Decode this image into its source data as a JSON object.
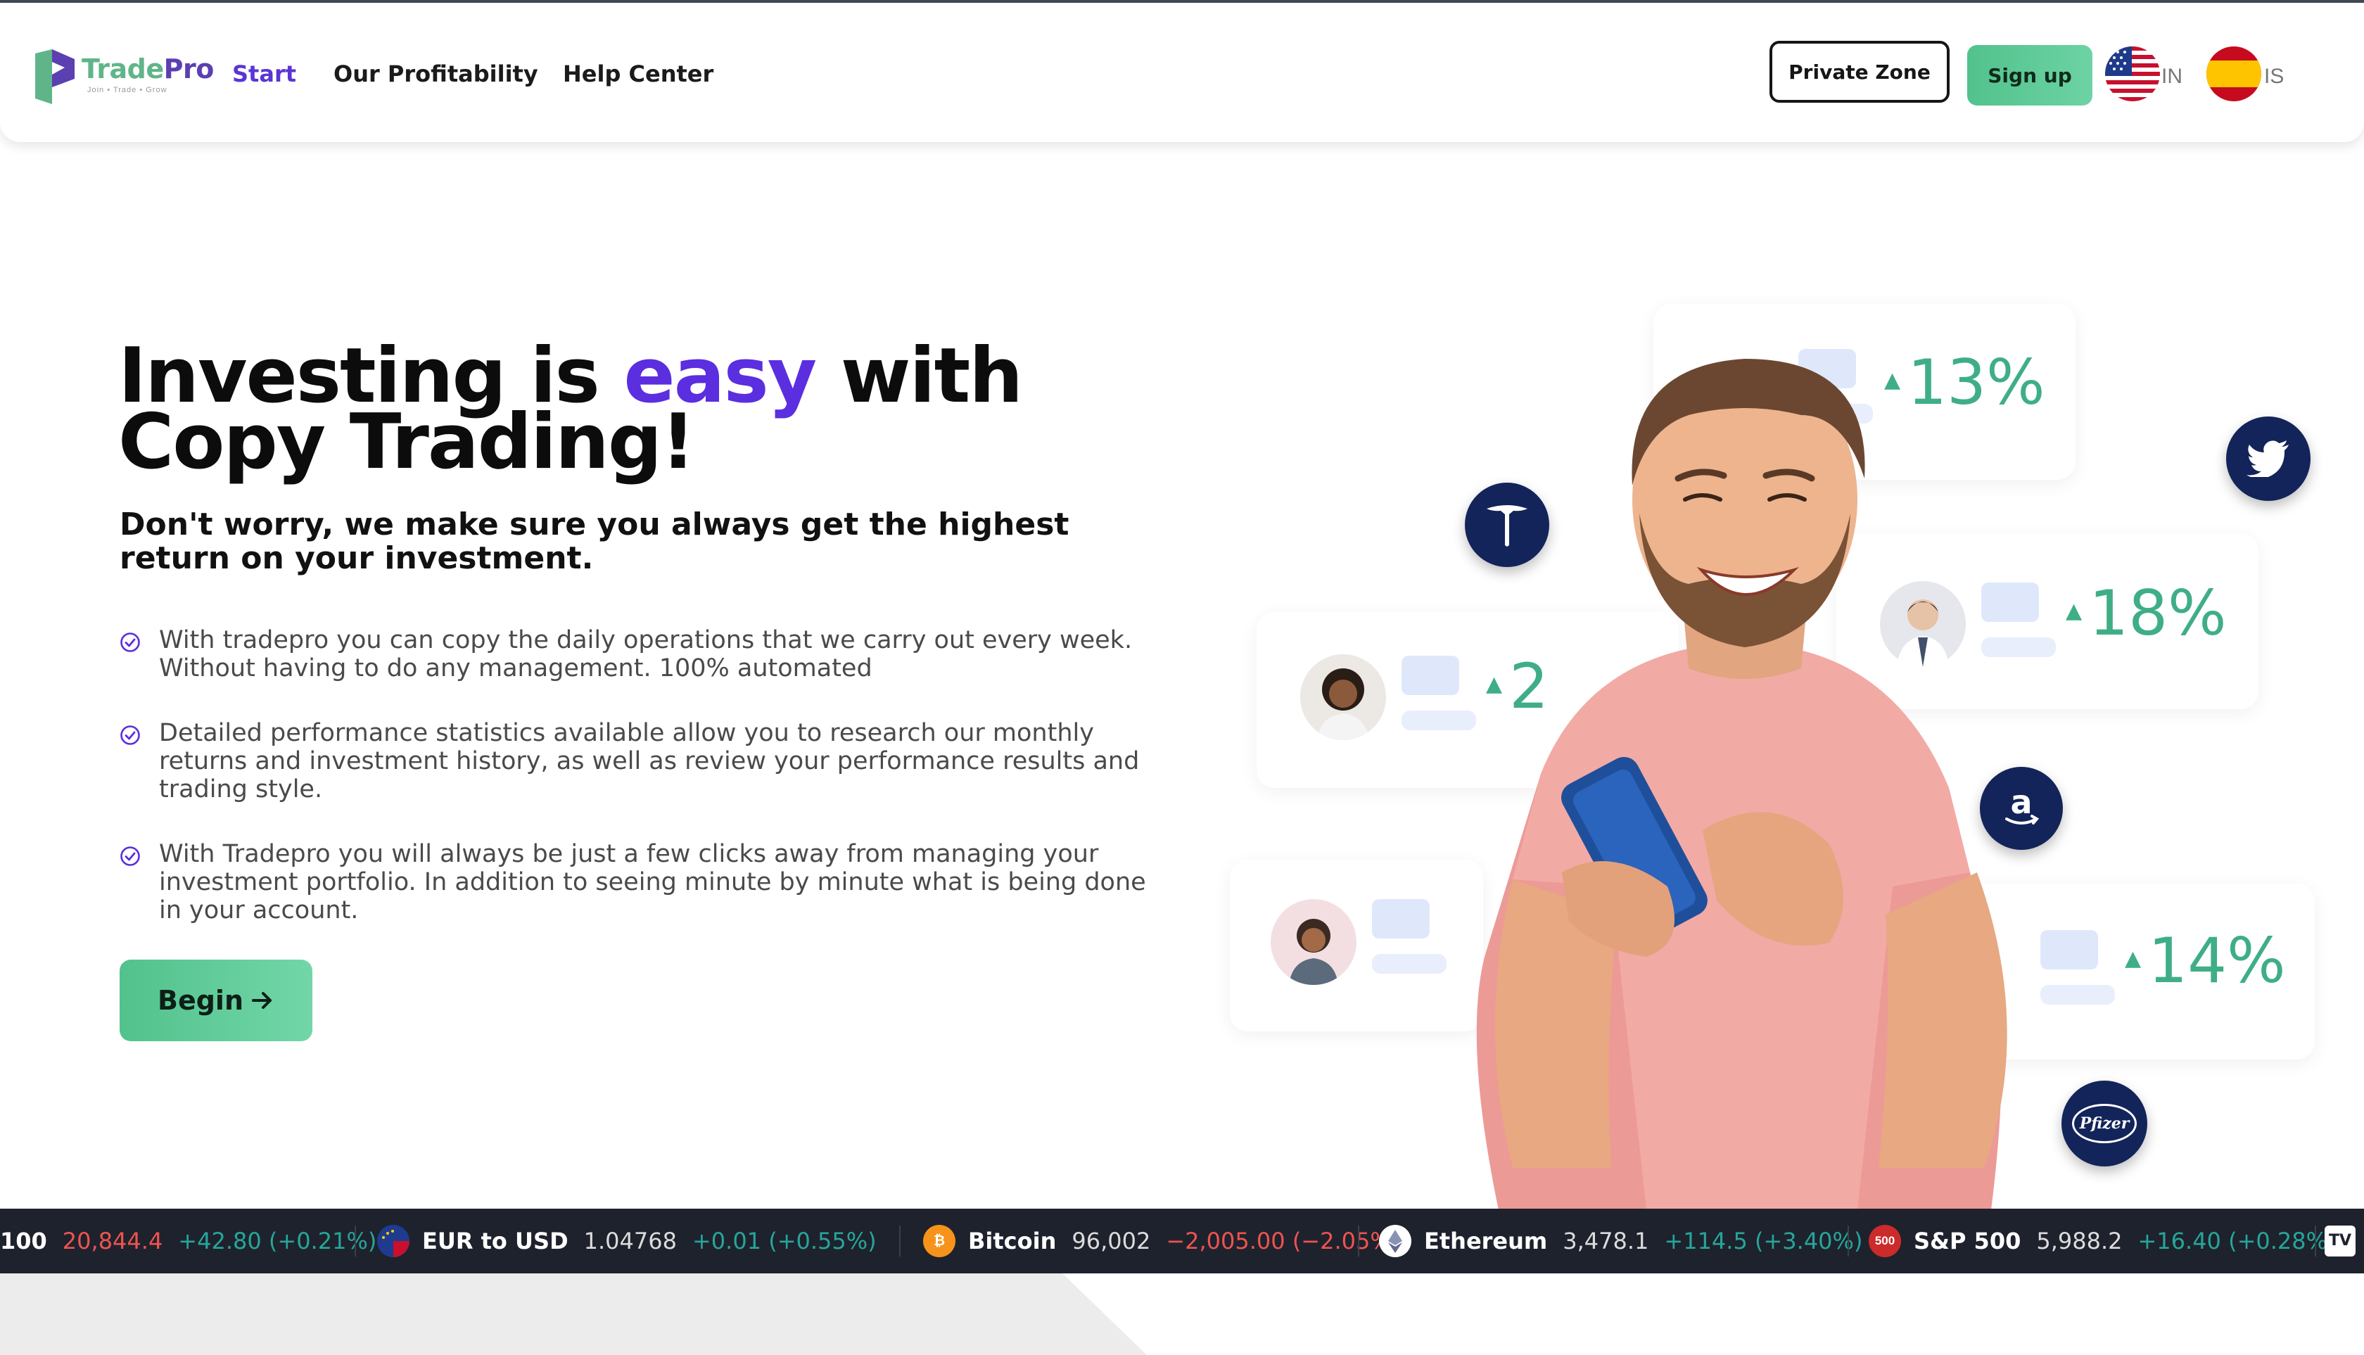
{
  "header": {
    "logo": {
      "part1": "Trade",
      "part2": "Pro",
      "tagline": "Join • Trade • Grow"
    },
    "nav": [
      {
        "label": "Start",
        "active": true
      },
      {
        "label": "Our Profitability",
        "active": false
      },
      {
        "label": "Help Center",
        "active": false
      }
    ],
    "private_zone_label": "Private Zone",
    "signup_label": "Sign up",
    "languages": [
      {
        "code": "IN",
        "flag": "us-flag-icon"
      },
      {
        "code": "IS",
        "flag": "es-flag-icon"
      }
    ]
  },
  "hero": {
    "title_part1": "Investing is ",
    "title_highlight": "easy",
    "title_part2": " with",
    "title_line2": "Copy Trading!",
    "subtitle": "Don't worry, we make sure you always get the highest return on your investment.",
    "bullets": [
      "With tradepro you can copy the daily operations that we carry out every week. Without having to do any management. 100% automated",
      "Detailed performance statistics available allow you to research our monthly returns and investment history, as well as review your performance results and trading style.",
      "With Tradepro you will always be just a few clicks away from managing your investment portfolio. In addition to seeing minute by minute what is being done in your account."
    ],
    "begin_label": "Begin",
    "accent_color": "#5b2ee0",
    "green_color": "#5fc896"
  },
  "illustration": {
    "cards": [
      {
        "pct": "13%"
      },
      {
        "pct": "18%"
      },
      {
        "pct": "2"
      },
      {
        "pct": "14%"
      }
    ],
    "badges": [
      "tesla-icon",
      "twitter-icon",
      "amazon-icon",
      "pfizer-icon"
    ],
    "pfizer_text": "Pfizer"
  },
  "ticker": [
    {
      "name": "100",
      "price": "20,844.4",
      "change": "+42.80 (+0.21%)",
      "price_dir": "down",
      "change_dir": "up",
      "icon": ""
    },
    {
      "name": "EUR to USD",
      "price": "1.04768",
      "change": "+0.01 (+0.55%)",
      "change_dir": "up",
      "icon": "eu-us-flag-icon"
    },
    {
      "name": "Bitcoin",
      "price": "96,002",
      "change": "−2,005.00 (−2.05%",
      "change_dir": "down",
      "icon": "bitcoin-icon"
    },
    {
      "name": "Ethereum",
      "price": "3,478.1",
      "change": "+114.5 (+3.40%)",
      "change_dir": "up",
      "icon": "ethereum-icon"
    },
    {
      "name": "S&P 500",
      "price": "5,988.2",
      "change": "+16.40 (+0.28%)",
      "change_dir": "up",
      "icon": "sp500-icon",
      "icon_text": "500"
    }
  ],
  "ticker_brand": "TV"
}
